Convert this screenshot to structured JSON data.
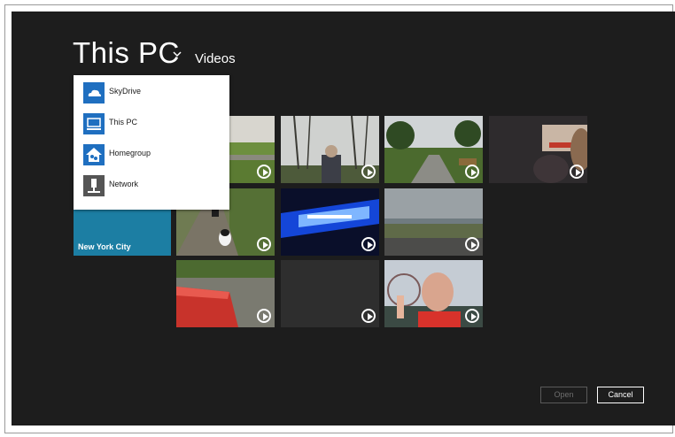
{
  "header": {
    "location": "This PC",
    "current_folder": "Videos"
  },
  "location_menu": {
    "items": [
      {
        "label": "SkyDrive",
        "icon": "cloud-icon"
      },
      {
        "label": "This PC",
        "icon": "computer-icon"
      },
      {
        "label": "Homegroup",
        "icon": "homegroup-icon"
      },
      {
        "label": "Network",
        "icon": "network-icon"
      }
    ]
  },
  "folders": [
    {
      "label": "New York City",
      "color": "#1c7ea3"
    }
  ],
  "videos": [
    {
      "scene": "green field and road"
    },
    {
      "scene": "man standing among bare trees"
    },
    {
      "scene": "park with palm trees and bench"
    },
    {
      "scene": "dark interior with funfair lights"
    },
    {
      "scene": "dogs walking on a path"
    },
    {
      "scene": "blue neon lights at night"
    },
    {
      "scene": "seafront promenade and grey sky"
    },
    {
      "scene": "red car bonnet on road"
    },
    {
      "scene": "dark empty frame"
    },
    {
      "scene": "man pointing at camera near ferris wheel"
    }
  ],
  "buttons": {
    "open": "Open",
    "cancel": "Cancel"
  },
  "colors": {
    "background": "#1d1d1d",
    "folder_tile": "#1c7ea3",
    "menu_icon": "#1f6fc0"
  }
}
